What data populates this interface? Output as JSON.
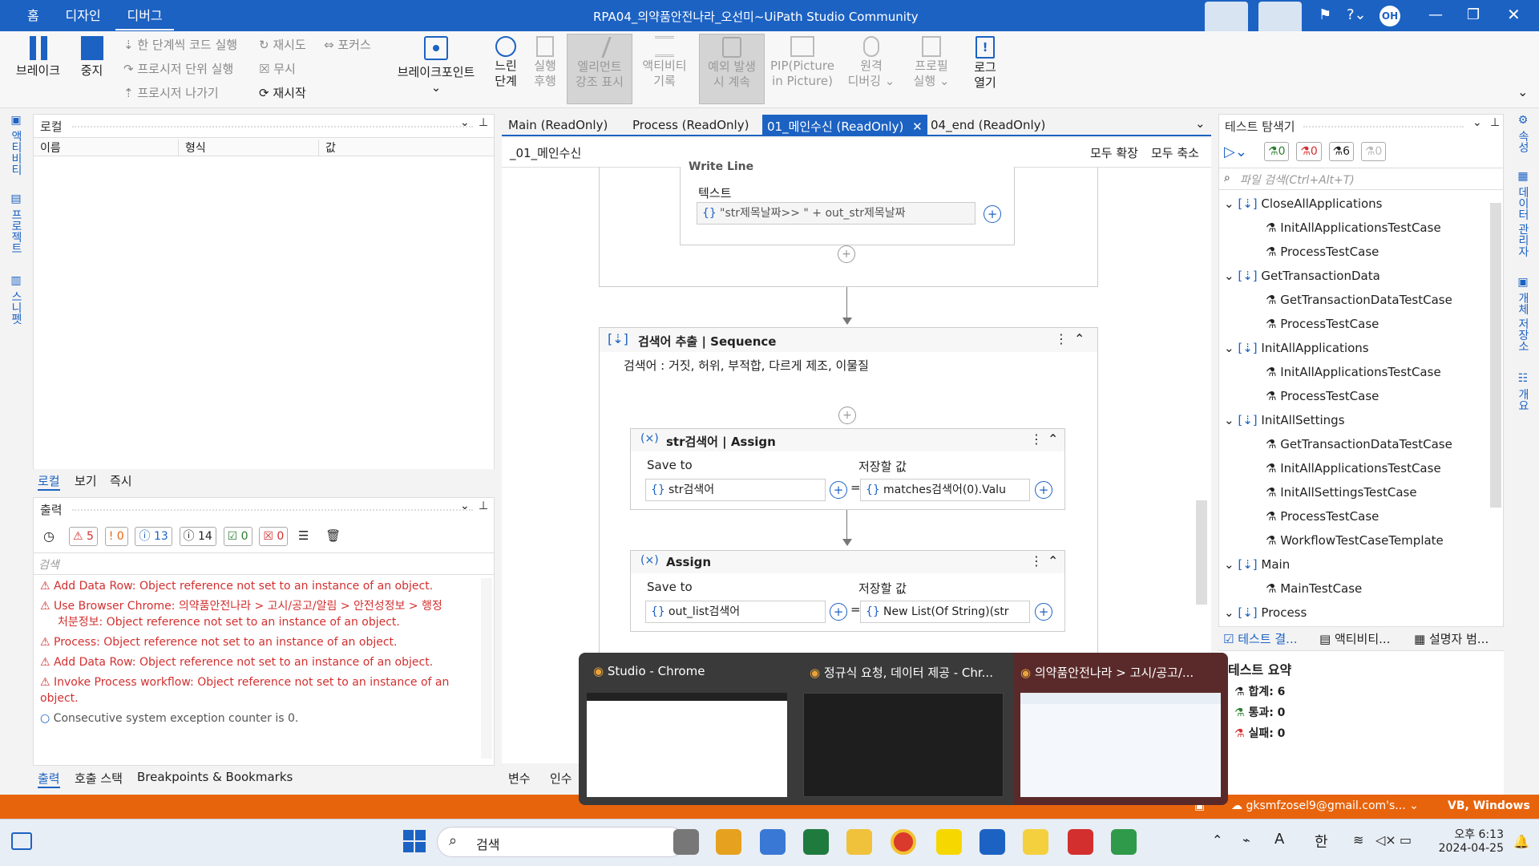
{
  "title_bar": {
    "menus": [
      "홈",
      "디자인",
      "디버그"
    ],
    "title": "RPA04_의약품안전나라_오선미~UiPath Studio Community",
    "user_initials": "OH"
  },
  "ribbon": {
    "break": "브레이크",
    "stop": "중지",
    "step_into": "한 단계씩 코드 실행",
    "retry": "재시도",
    "focus": "포커스",
    "step_over": "프로시저 단위 실행",
    "ignore": "무시",
    "step_out": "프로시저 나가기",
    "restart": "재시작",
    "breakpoints": "브레이크포인트",
    "slow_step": [
      "느린",
      "단계"
    ],
    "exec_trail": [
      "실행",
      "후행"
    ],
    "highlight": [
      "엘리먼트",
      "강조 표시"
    ],
    "log_activities": [
      "액티비티",
      "기록"
    ],
    "continue_exception": [
      "예외 발생",
      "시 계속"
    ],
    "pip": [
      "PIP(Picture",
      "in Picture)"
    ],
    "remote": [
      "원격",
      "디버깅"
    ],
    "profile": [
      "프로필",
      "실행"
    ],
    "open_logs": [
      "로그",
      "열기"
    ]
  },
  "left_strip": [
    "액티비티",
    "프로젝트",
    "스니펫"
  ],
  "locals": {
    "title": "로컬",
    "columns": [
      "이름",
      "형식",
      "값"
    ],
    "tabs": [
      "로컬",
      "보기",
      "즉시"
    ]
  },
  "output": {
    "title": "출력",
    "counts": {
      "errors": "5",
      "warnings": "0",
      "info": "13",
      "trace": "14",
      "success": "0",
      "fail": "0"
    },
    "search_placeholder": "검색",
    "messages": [
      {
        "type": "error",
        "text": "Add Data Row: Object reference not set to an instance of an object."
      },
      {
        "type": "error",
        "text": "Use Browser Chrome: 의약품안전나라 > 고시/공고/알림 > 안전성정보 > 행정"
      },
      {
        "type": "error-cont",
        "text": "처분정보: Object reference not set to an instance of an object."
      },
      {
        "type": "error",
        "text": "Process: Object reference not set to an instance of an object."
      },
      {
        "type": "error",
        "text": "Add Data Row: Object reference not set to an instance of an object."
      },
      {
        "type": "error",
        "text": "Invoke Process workflow: Object reference not set to an instance of an object."
      },
      {
        "type": "info",
        "text": "Consecutive system exception counter is 0."
      }
    ],
    "tabs": [
      "출력",
      "호출 스택",
      "Breakpoints & Bookmarks"
    ]
  },
  "doc_tabs": [
    "Main (ReadOnly)",
    "Process (ReadOnly)",
    "01_메인수신 (ReadOnly)",
    "04_end (ReadOnly)"
  ],
  "designer": {
    "breadcrumb": "_01_메인수신",
    "expand_all": "모두 확장",
    "collapse_all": "모두 축소",
    "writeline": {
      "title": "Write Line",
      "text_label": "텍스트",
      "text_value": "\"str제목날짜>> \" + out_str제목날짜"
    },
    "sequence": {
      "title": "검색어 추출 | Sequence",
      "annotation": "검색어 : 거짓, 허위, 부적합, 다르게 제조, 이물질"
    },
    "assign1": {
      "title": "str검색어 | Assign",
      "save_to": "Save to",
      "value_label": "저장할 값",
      "to_value": "str검색어",
      "value": "matches검색어(0).Valu"
    },
    "assign2": {
      "title": "Assign",
      "save_to": "Save to",
      "value_label": "저장할 값",
      "to_value": "out_list검색어",
      "value": "New List(Of String)(str"
    },
    "bottom_tabs": [
      "변수",
      "인수"
    ]
  },
  "test_explorer": {
    "title": "테스트 탐색기",
    "counts": {
      "passed": "0",
      "failed": "0",
      "total": "6",
      "none": "0"
    },
    "search_placeholder": "파일 검색(Ctrl+Alt+T)",
    "tree": [
      {
        "level": 0,
        "label": "CloseAllApplications"
      },
      {
        "level": 1,
        "label": "InitAllApplicationsTestCase"
      },
      {
        "level": 1,
        "label": "ProcessTestCase"
      },
      {
        "level": 0,
        "label": "GetTransactionData"
      },
      {
        "level": 1,
        "label": "GetTransactionDataTestCase"
      },
      {
        "level": 1,
        "label": "ProcessTestCase"
      },
      {
        "level": 0,
        "label": "InitAllApplications"
      },
      {
        "level": 1,
        "label": "InitAllApplicationsTestCase"
      },
      {
        "level": 1,
        "label": "ProcessTestCase"
      },
      {
        "level": 0,
        "label": "InitAllSettings"
      },
      {
        "level": 1,
        "label": "GetTransactionDataTestCase"
      },
      {
        "level": 1,
        "label": "InitAllApplicationsTestCase"
      },
      {
        "level": 1,
        "label": "InitAllSettingsTestCase"
      },
      {
        "level": 1,
        "label": "ProcessTestCase"
      },
      {
        "level": 1,
        "label": "WorkflowTestCaseTemplate"
      },
      {
        "level": 0,
        "label": "Main"
      },
      {
        "level": 1,
        "label": "MainTestCase"
      },
      {
        "level": 0,
        "label": "Process"
      }
    ],
    "bottom_tabs": [
      "테스트 결...",
      "액티비티...",
      "설명자 범..."
    ],
    "summary": {
      "title": "테스트 요약",
      "total": "합계: 6",
      "passed": "통과: 0",
      "failed": "실패: 0"
    }
  },
  "right_strip": [
    "속성",
    "데이터 관리자",
    "개체 저장소",
    "개요"
  ],
  "status_bar": {
    "email": "gksmfzosel9@gmail.com's...",
    "lang": "VB, Windows"
  },
  "taskbar": {
    "search": "검색",
    "time": "오후 6:13",
    "date": "2024-04-25",
    "ime": "한",
    "ime2": "A"
  },
  "chrome_previews": [
    "Studio - Chrome",
    "정규식 요청, 데이터 제공 - Chr...",
    "의약품안전나라 > 고시/공고/..."
  ],
  "colors": {
    "accent": "#1c62c3",
    "status": "#e8640c",
    "error": "#d32f2f"
  }
}
